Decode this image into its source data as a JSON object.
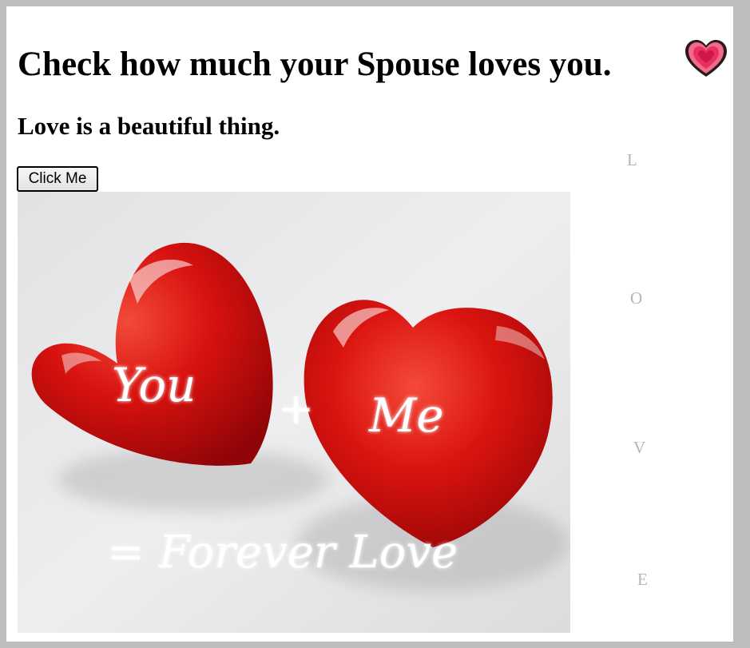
{
  "header": {
    "title": "Check how much your Spouse loves you.",
    "subtitle": "Love is a beautiful thing."
  },
  "actions": {
    "click_label": "Click Me"
  },
  "side_letters": [
    "L",
    "O",
    "V",
    "E"
  ],
  "image": {
    "text_you": "You",
    "text_plus": "+",
    "text_me": "Me",
    "text_forever": "= Forever Love"
  },
  "icons": {
    "title_icon": "heart-icon"
  },
  "colors": {
    "page_border": "#bdbdbd",
    "heart_red": "#d0101a",
    "letter_gray": "#b5b5b5"
  }
}
